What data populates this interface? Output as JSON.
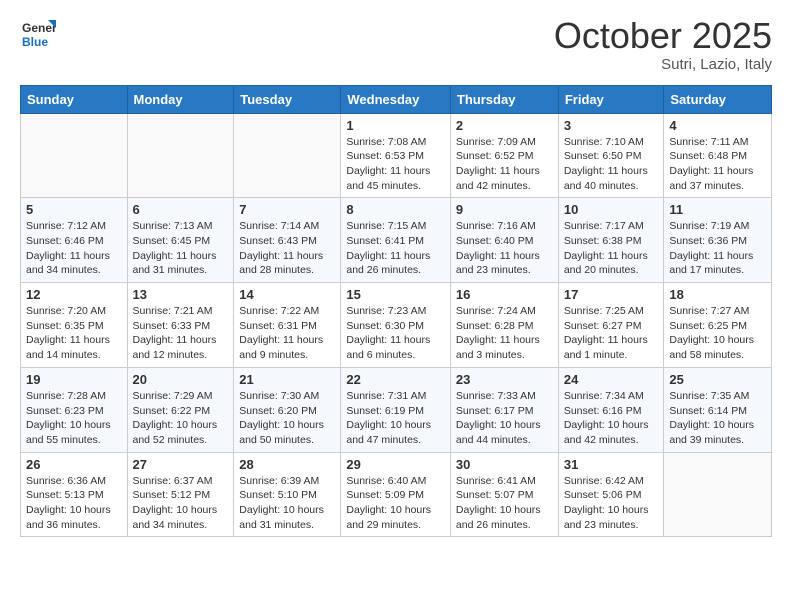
{
  "header": {
    "logo": {
      "line1": "General",
      "line2": "Blue"
    },
    "month": "October 2025",
    "location": "Sutri, Lazio, Italy"
  },
  "weekdays": [
    "Sunday",
    "Monday",
    "Tuesday",
    "Wednesday",
    "Thursday",
    "Friday",
    "Saturday"
  ],
  "weeks": [
    [
      {
        "day": "",
        "info": ""
      },
      {
        "day": "",
        "info": ""
      },
      {
        "day": "",
        "info": ""
      },
      {
        "day": "1",
        "info": "Sunrise: 7:08 AM\nSunset: 6:53 PM\nDaylight: 11 hours and 45 minutes."
      },
      {
        "day": "2",
        "info": "Sunrise: 7:09 AM\nSunset: 6:52 PM\nDaylight: 11 hours and 42 minutes."
      },
      {
        "day": "3",
        "info": "Sunrise: 7:10 AM\nSunset: 6:50 PM\nDaylight: 11 hours and 40 minutes."
      },
      {
        "day": "4",
        "info": "Sunrise: 7:11 AM\nSunset: 6:48 PM\nDaylight: 11 hours and 37 minutes."
      }
    ],
    [
      {
        "day": "5",
        "info": "Sunrise: 7:12 AM\nSunset: 6:46 PM\nDaylight: 11 hours and 34 minutes."
      },
      {
        "day": "6",
        "info": "Sunrise: 7:13 AM\nSunset: 6:45 PM\nDaylight: 11 hours and 31 minutes."
      },
      {
        "day": "7",
        "info": "Sunrise: 7:14 AM\nSunset: 6:43 PM\nDaylight: 11 hours and 28 minutes."
      },
      {
        "day": "8",
        "info": "Sunrise: 7:15 AM\nSunset: 6:41 PM\nDaylight: 11 hours and 26 minutes."
      },
      {
        "day": "9",
        "info": "Sunrise: 7:16 AM\nSunset: 6:40 PM\nDaylight: 11 hours and 23 minutes."
      },
      {
        "day": "10",
        "info": "Sunrise: 7:17 AM\nSunset: 6:38 PM\nDaylight: 11 hours and 20 minutes."
      },
      {
        "day": "11",
        "info": "Sunrise: 7:19 AM\nSunset: 6:36 PM\nDaylight: 11 hours and 17 minutes."
      }
    ],
    [
      {
        "day": "12",
        "info": "Sunrise: 7:20 AM\nSunset: 6:35 PM\nDaylight: 11 hours and 14 minutes."
      },
      {
        "day": "13",
        "info": "Sunrise: 7:21 AM\nSunset: 6:33 PM\nDaylight: 11 hours and 12 minutes."
      },
      {
        "day": "14",
        "info": "Sunrise: 7:22 AM\nSunset: 6:31 PM\nDaylight: 11 hours and 9 minutes."
      },
      {
        "day": "15",
        "info": "Sunrise: 7:23 AM\nSunset: 6:30 PM\nDaylight: 11 hours and 6 minutes."
      },
      {
        "day": "16",
        "info": "Sunrise: 7:24 AM\nSunset: 6:28 PM\nDaylight: 11 hours and 3 minutes."
      },
      {
        "day": "17",
        "info": "Sunrise: 7:25 AM\nSunset: 6:27 PM\nDaylight: 11 hours and 1 minute."
      },
      {
        "day": "18",
        "info": "Sunrise: 7:27 AM\nSunset: 6:25 PM\nDaylight: 10 hours and 58 minutes."
      }
    ],
    [
      {
        "day": "19",
        "info": "Sunrise: 7:28 AM\nSunset: 6:23 PM\nDaylight: 10 hours and 55 minutes."
      },
      {
        "day": "20",
        "info": "Sunrise: 7:29 AM\nSunset: 6:22 PM\nDaylight: 10 hours and 52 minutes."
      },
      {
        "day": "21",
        "info": "Sunrise: 7:30 AM\nSunset: 6:20 PM\nDaylight: 10 hours and 50 minutes."
      },
      {
        "day": "22",
        "info": "Sunrise: 7:31 AM\nSunset: 6:19 PM\nDaylight: 10 hours and 47 minutes."
      },
      {
        "day": "23",
        "info": "Sunrise: 7:33 AM\nSunset: 6:17 PM\nDaylight: 10 hours and 44 minutes."
      },
      {
        "day": "24",
        "info": "Sunrise: 7:34 AM\nSunset: 6:16 PM\nDaylight: 10 hours and 42 minutes."
      },
      {
        "day": "25",
        "info": "Sunrise: 7:35 AM\nSunset: 6:14 PM\nDaylight: 10 hours and 39 minutes."
      }
    ],
    [
      {
        "day": "26",
        "info": "Sunrise: 6:36 AM\nSunset: 5:13 PM\nDaylight: 10 hours and 36 minutes."
      },
      {
        "day": "27",
        "info": "Sunrise: 6:37 AM\nSunset: 5:12 PM\nDaylight: 10 hours and 34 minutes."
      },
      {
        "day": "28",
        "info": "Sunrise: 6:39 AM\nSunset: 5:10 PM\nDaylight: 10 hours and 31 minutes."
      },
      {
        "day": "29",
        "info": "Sunrise: 6:40 AM\nSunset: 5:09 PM\nDaylight: 10 hours and 29 minutes."
      },
      {
        "day": "30",
        "info": "Sunrise: 6:41 AM\nSunset: 5:07 PM\nDaylight: 10 hours and 26 minutes."
      },
      {
        "day": "31",
        "info": "Sunrise: 6:42 AM\nSunset: 5:06 PM\nDaylight: 10 hours and 23 minutes."
      },
      {
        "day": "",
        "info": ""
      }
    ]
  ]
}
